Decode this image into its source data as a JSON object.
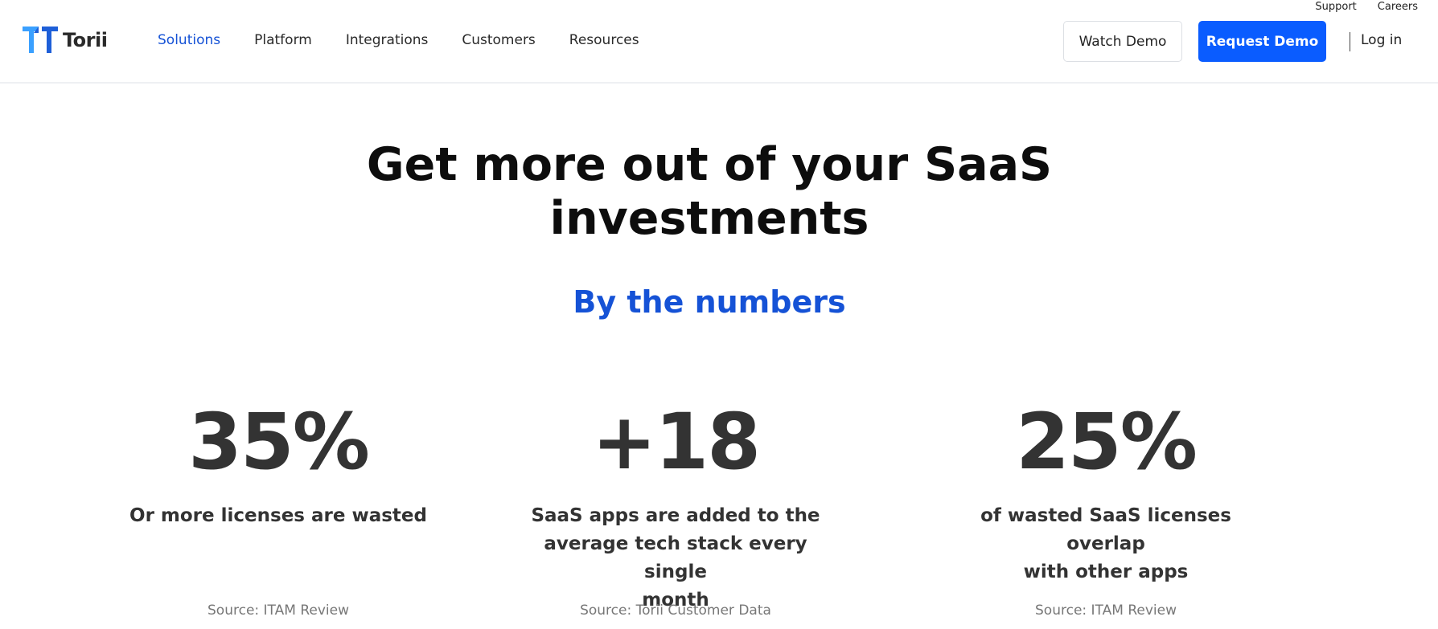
{
  "utility": {
    "support": "Support",
    "careers": "Careers"
  },
  "brand": {
    "name": "Torii",
    "logo_color": "#3aa0ff"
  },
  "nav": {
    "items": [
      {
        "label": "Solutions",
        "active": true
      },
      {
        "label": "Platform",
        "active": false
      },
      {
        "label": "Integrations",
        "active": false
      },
      {
        "label": "Customers",
        "active": false
      },
      {
        "label": "Resources",
        "active": false
      }
    ]
  },
  "actions": {
    "watch_demo": "Watch Demo",
    "request_demo": "Request Demo",
    "login": "Log in"
  },
  "hero": {
    "title_line1": "Get more out of your SaaS",
    "title_line2": "investments",
    "subtitle": "By the numbers"
  },
  "stats": [
    {
      "value": "35%",
      "desc_lines": [
        "Or more licenses are wasted"
      ],
      "source": "Source: ITAM Review"
    },
    {
      "value": "+18",
      "desc_lines": [
        "SaaS apps are added to the",
        "average tech stack every single",
        "month"
      ],
      "source": "Source: Torii Customer Data"
    },
    {
      "value": "25%",
      "desc_lines": [
        "of wasted SaaS licenses overlap",
        "with other apps"
      ],
      "source": "Source: ITAM Review"
    }
  ],
  "colors": {
    "primary": "#0a5cff",
    "accent_text": "#1552d6",
    "heading": "#0d0d0d",
    "stat": "#333333"
  }
}
